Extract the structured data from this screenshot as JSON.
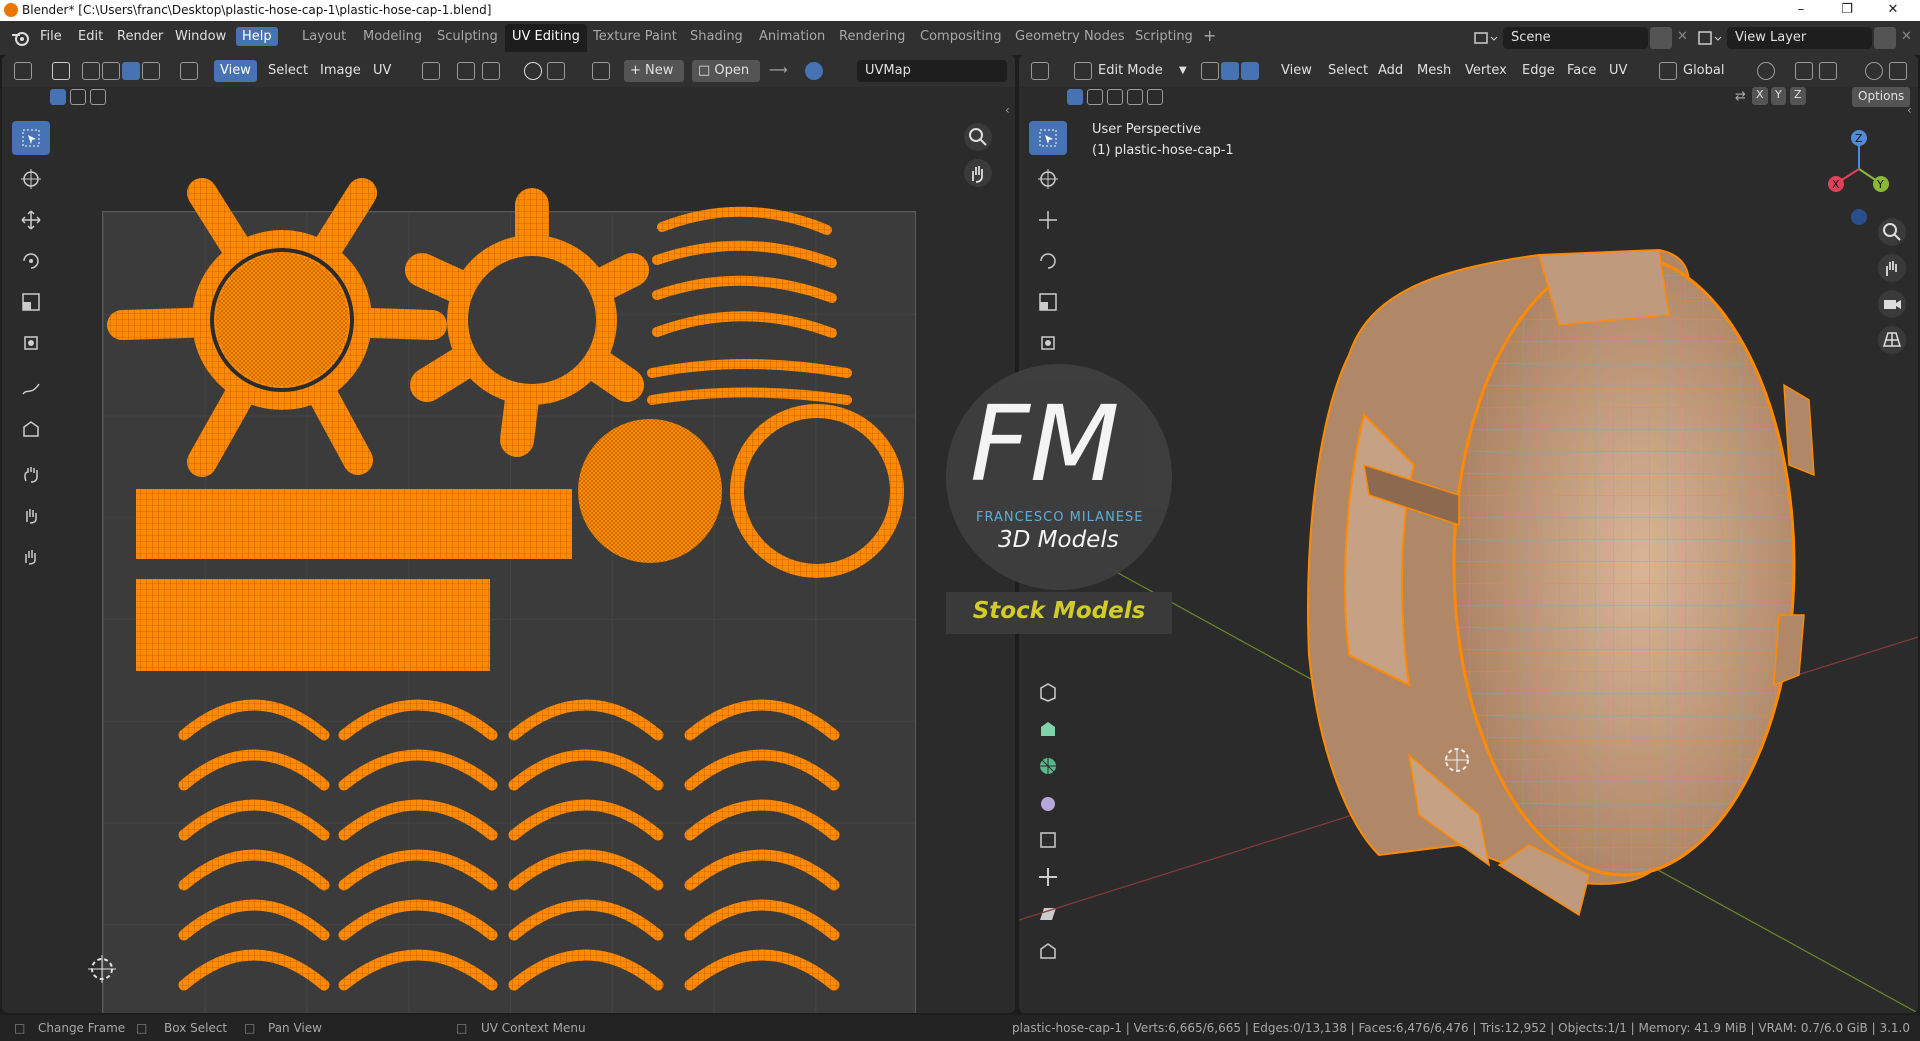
{
  "window": {
    "title": "Blender* [C:\\Users\\franc\\Desktop\\plastic-hose-cap-1\\plastic-hose-cap-1.blend]"
  },
  "menu": [
    "File",
    "Edit",
    "Render",
    "Window",
    "Help"
  ],
  "workspaces": [
    "Layout",
    "Modeling",
    "Sculpting",
    "UV Editing",
    "Texture Paint",
    "Shading",
    "Animation",
    "Rendering",
    "Compositing",
    "Geometry Nodes",
    "Scripting"
  ],
  "active_workspace": "UV Editing",
  "scene": {
    "label": "Scene",
    "view_layer": "View Layer"
  },
  "uv_editor": {
    "menu": [
      "View",
      "Select",
      "Image",
      "UV"
    ],
    "new_label": "New",
    "open_label": "Open",
    "uvmap": "UVMap"
  },
  "viewport": {
    "mode": "Edit Mode",
    "menu": [
      "View",
      "Select",
      "Add",
      "Mesh",
      "Vertex",
      "Edge",
      "Face",
      "UV"
    ],
    "orientation": "Global",
    "axes": [
      "X",
      "Y",
      "Z"
    ],
    "options_label": "Options",
    "perspective": "User Perspective",
    "object": "(1) plastic-hose-cap-1",
    "gizmo_axes": {
      "z": "Z",
      "y": "Y",
      "x": "X"
    }
  },
  "watermark": {
    "logo": "FM",
    "line1": "FRANCESCO MILANESE",
    "line2": "3D Models",
    "badge": "Stock Models"
  },
  "status": {
    "change_frame": "Change Frame",
    "box_select": "Box Select",
    "pan_view": "Pan View",
    "context_menu": "UV Context Menu",
    "stats": "plastic-hose-cap-1 | Verts:6,665/6,665 | Edges:0/13,138 | Faces:6,476/6,476 | Tris:12,952 | Objects:1/1 | Memory: 41.9 MiB | VRAM: 0.7/6.0 GiB | 3.1.0"
  },
  "colors": {
    "accent": "#4772b3",
    "selection": "#ff8a00",
    "header": "#303030",
    "editor_bg": "#2b2b2b"
  }
}
